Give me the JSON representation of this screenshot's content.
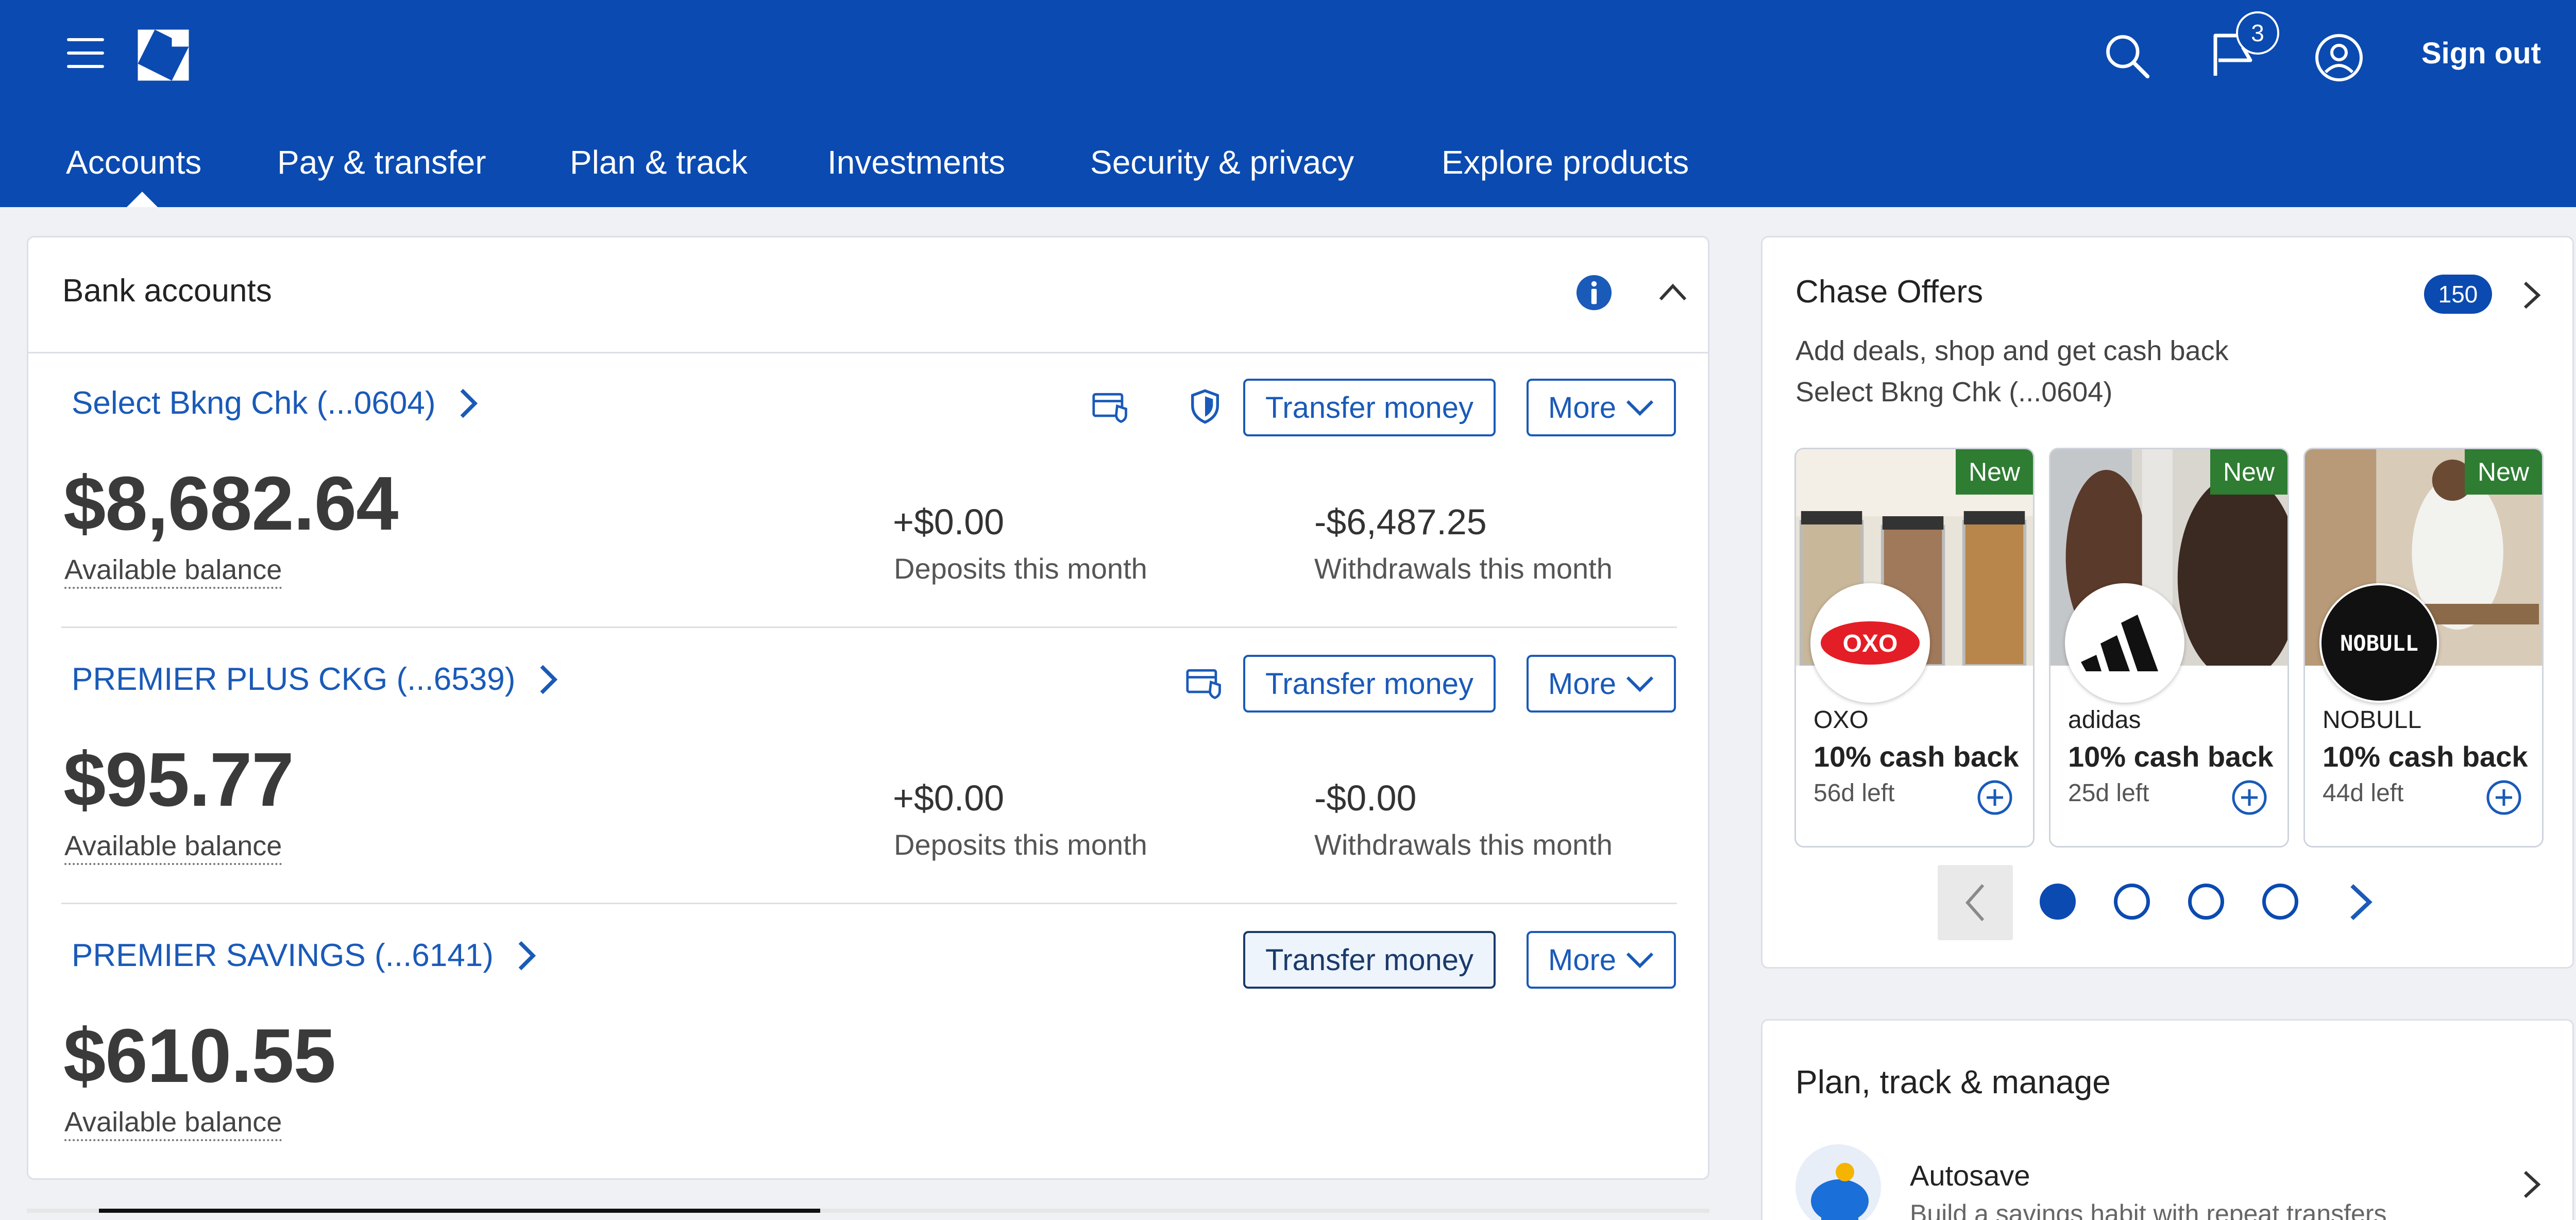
{
  "header": {
    "notification_count": "3",
    "sign_out_label": "Sign out",
    "icons": [
      "menu-icon",
      "chase-logo-icon",
      "search-icon",
      "notifications-flag-icon",
      "user-profile-icon"
    ],
    "brand_color": "#0b4ab0"
  },
  "nav": {
    "items": [
      {
        "label": "Accounts"
      },
      {
        "label": "Pay & transfer"
      },
      {
        "label": "Plan & track"
      },
      {
        "label": "Investments"
      },
      {
        "label": "Security & privacy"
      },
      {
        "label": "Explore products"
      }
    ],
    "active": "Accounts"
  },
  "bank": {
    "title": "Bank accounts",
    "accounts": [
      {
        "name": "Select Bkng Chk (...0604)",
        "transfer_label": "Transfer money",
        "more_label": "More",
        "balance": "$8,682.64",
        "balance_label": "Available balance",
        "deposits": "+$0.00",
        "deposits_label": "Deposits this month",
        "withdrawals": "-$6,487.25",
        "withdrawals_label": "Withdrawals this month"
      },
      {
        "name": "PREMIER PLUS CKG (...6539)",
        "transfer_label": "Transfer money",
        "more_label": "More",
        "balance": "$95.77",
        "balance_label": "Available balance",
        "deposits": "+$0.00",
        "deposits_label": "Deposits this month",
        "withdrawals": "-$0.00",
        "withdrawals_label": "Withdrawals this month"
      },
      {
        "name": "PREMIER SAVINGS (...6141)",
        "transfer_label": "Transfer money",
        "more_label": "More",
        "balance": "$610.55",
        "balance_label": "Available balance"
      }
    ]
  },
  "offers": {
    "title": "Chase Offers",
    "count": "150",
    "subtitle": "Add deals, shop and get cash back",
    "account": "Select Bkng Chk (...0604)",
    "tiles": [
      {
        "badge": "New",
        "merchant": "OXO",
        "logo_text": "OXO",
        "cashback": "10% cash back",
        "days_left": "56d left"
      },
      {
        "badge": "New",
        "merchant": "adidas",
        "cashback": "10% cash back",
        "days_left": "25d left"
      },
      {
        "badge": "New",
        "merchant": "NOBULL",
        "logo_text": "NOBULL",
        "cashback": "10% cash back",
        "days_left": "44d left"
      }
    ],
    "page_count": 4,
    "current_page": 1
  },
  "plan": {
    "title": "Plan, track & manage",
    "autosave_label": "Autosave",
    "autosave_sub": "Build a savings habit with repeat transfers"
  }
}
